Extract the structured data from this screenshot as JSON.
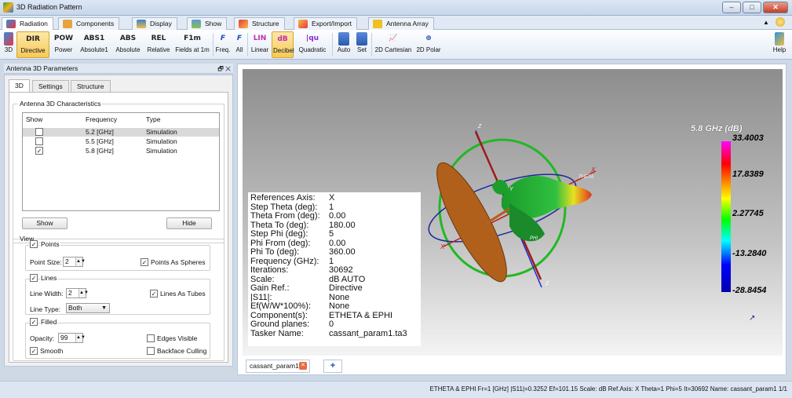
{
  "window": {
    "title": "3D Radiation Pattern",
    "min": "–",
    "max": "□",
    "close": "✕"
  },
  "ribbon_tabs": [
    "Radiation",
    "Components",
    "Display",
    "Show",
    "Structure",
    "Export/Import",
    "Antenna Array"
  ],
  "ribbon_buttons": {
    "b3d": "3D",
    "directive": {
      "icon": "DIR",
      "label": "Directive"
    },
    "power": {
      "icon": "POW",
      "label": "Power"
    },
    "absolute1": {
      "icon": "ABS1",
      "label": "Absolute1"
    },
    "absolute": {
      "icon": "ABS",
      "label": "Absolute"
    },
    "relative": {
      "icon": "REL",
      "label": "Relative"
    },
    "fields": {
      "icon": "F1m",
      "label": "Fields at 1m"
    },
    "freq": "Freq.",
    "all": "All",
    "linear": {
      "icon": "LIN",
      "label": "Linear"
    },
    "decibel": {
      "icon": "dB",
      "label": "Decibel"
    },
    "quadratic": {
      "icon": "|qu",
      "label": "Quadratic"
    },
    "auto": "Auto",
    "set": "Set",
    "cartesian": "2D Cartesian",
    "polar": "2D Polar",
    "help": "Help"
  },
  "panel": {
    "title": "Antenna 3D Parameters",
    "controls": "🗗 ✕",
    "tabs": [
      "3D",
      "Settings",
      "Structure"
    ],
    "group_title": "Antenna 3D Characteristics",
    "columns": [
      "Show",
      "Frequency",
      "Type"
    ],
    "rows": [
      {
        "checked": "",
        "freq": "5.2 [GHz]",
        "type": "Simulation"
      },
      {
        "checked": "",
        "freq": "5.5 [GHz]",
        "type": "Simulation"
      },
      {
        "checked": "✓",
        "freq": "5.8 [GHz]",
        "type": "Simulation"
      }
    ],
    "show_button": "Show",
    "hide_button": "Hide",
    "view_title": "View",
    "points": {
      "label": "Points",
      "size_label": "Point Size:",
      "size": "2",
      "spheres": "Points As Spheres"
    },
    "lines": {
      "label": "Lines",
      "width_label": "Line Width:",
      "width": "2",
      "tubes": "Lines As Tubes",
      "type_label": "Line Type:",
      "type": "Both"
    },
    "filled": {
      "label": "Filled",
      "opacity_label": "Opacity:",
      "opacity": "99",
      "edges": "Edges Visible",
      "smooth": "Smooth",
      "culling": "Backface Culling"
    }
  },
  "info": [
    {
      "k": "References Axis:",
      "v": "X"
    },
    {
      "k": "Step Theta (deg):",
      "v": "1"
    },
    {
      "k": "Theta From (deg):",
      "v": "0.00"
    },
    {
      "k": "Theta To (deg):",
      "v": "180.00"
    },
    {
      "k": "Step Phi (deg):",
      "v": "5"
    },
    {
      "k": "Phi From (deg):",
      "v": "0.00"
    },
    {
      "k": "Phi To (deg):",
      "v": "360.00"
    },
    {
      "k": "Frequency (GHz):",
      "v": "1"
    },
    {
      "k": "Iterations:",
      "v": "30692"
    },
    {
      "k": "Scale:",
      "v": "dB AUTO"
    },
    {
      "k": "Gain Ref.:",
      "v": "Directive"
    },
    {
      "k": "|S11|:",
      "v": "None"
    },
    {
      "k": "Ef(W/W*100%):",
      "v": "None"
    },
    {
      "k": "Component(s):",
      "v": "ETHETA & EPHI"
    },
    {
      "k": "Ground planes:",
      "v": "0"
    },
    {
      "k": "Tasker Name:",
      "v": "cassant_param1.ta3"
    }
  ],
  "legend": {
    "title": "5.8 GHz (dB)",
    "values": [
      "33.4003",
      "17.8389",
      "2.27745",
      "-13.2840",
      "-28.8454"
    ]
  },
  "axes": {
    "x": "X",
    "y": "Y",
    "z": "Z",
    "theta": "THETA",
    "phi": "PHI"
  },
  "doc_tab": "cassant_param1",
  "status": "ETHETA & EPHI  Fr=1 [GHz]  |S11|=0.3252  Ef=101.15  Scale: dB  Ref.Axis: X  Theta=1  Phi=5  It=30692  Name: cassant_param1 1/1"
}
